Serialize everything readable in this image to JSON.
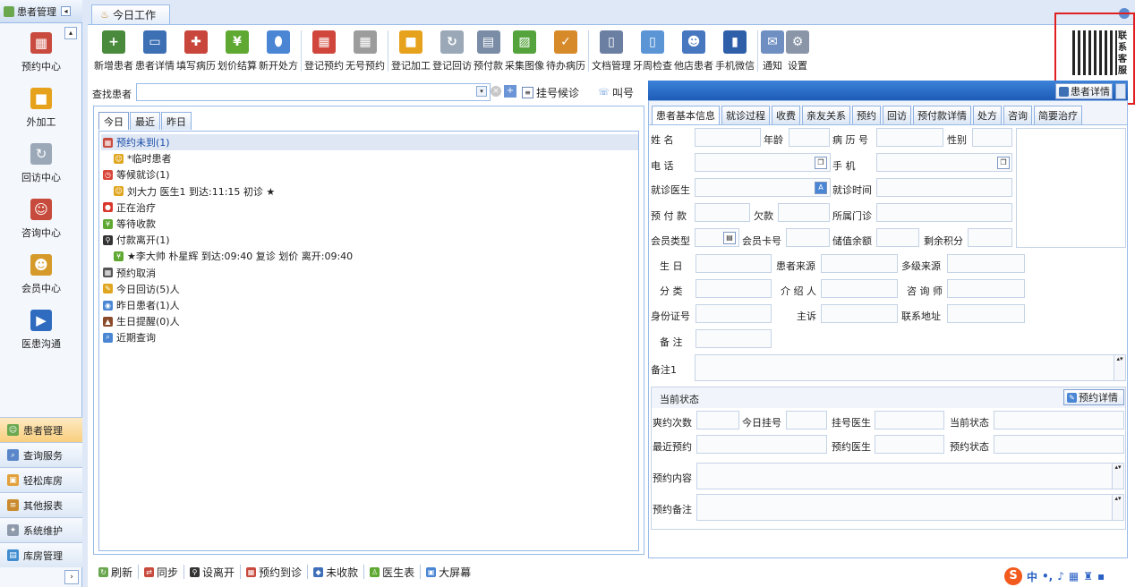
{
  "sidebar": {
    "header": "患者管理",
    "items": [
      {
        "label": "预约中心",
        "icon": "calendar-icon",
        "color": "#c94a3e"
      },
      {
        "label": "外加工",
        "icon": "blocks-icon",
        "color": "#e6a21c"
      },
      {
        "label": "回访中心",
        "icon": "refresh-icon",
        "color": "#9aa8b8"
      },
      {
        "label": "咨询中心",
        "icon": "consultant-icon",
        "color": "#c74b3c"
      },
      {
        "label": "会员中心",
        "icon": "members-icon",
        "color": "#d59a2a"
      },
      {
        "label": "医患沟通",
        "icon": "video-icon",
        "color": "#2f6cc0"
      }
    ],
    "menu": [
      {
        "label": "患者管理",
        "icon": "patients-icon",
        "color": "#6aa84f"
      },
      {
        "label": "查询服务",
        "icon": "query-icon",
        "color": "#5a87c9"
      },
      {
        "label": "轻松库房",
        "icon": "warehouse-icon",
        "color": "#e2a03a"
      },
      {
        "label": "其他报表",
        "icon": "report-icon",
        "color": "#c98b2e"
      },
      {
        "label": "系统维护",
        "icon": "wrench-icon",
        "color": "#8e9aab"
      },
      {
        "label": "库房管理",
        "icon": "storage-icon",
        "color": "#3f8ccf"
      }
    ]
  },
  "main_tab": {
    "label": "今日工作"
  },
  "toolbar": [
    {
      "label": "新增患者",
      "icon": "add-patient-icon",
      "color": "#4a8a3c"
    },
    {
      "label": "患者详情",
      "icon": "patient-card-icon",
      "color": "#3c6fb3"
    },
    {
      "label": "填写病历",
      "icon": "medical-record-icon",
      "color": "#c9463d"
    },
    {
      "label": "划价结算",
      "icon": "yen-icon",
      "color": "#5fa832"
    },
    {
      "label": "新开处方",
      "icon": "pill-icon",
      "color": "#4a86d4"
    },
    {
      "label": "登记预约",
      "icon": "calendar-icon",
      "color": "#d0463c"
    },
    {
      "label": "无号预约",
      "icon": "grid-calendar-icon",
      "color": "#9c9c9c"
    },
    {
      "label": "登记加工",
      "icon": "blocks-icon",
      "color": "#e6a21c"
    },
    {
      "label": "登记回访",
      "icon": "refresh-icon",
      "color": "#9aa8b8"
    },
    {
      "label": "预付款",
      "icon": "calculator-icon",
      "color": "#7a8ca6"
    },
    {
      "label": "采集图像",
      "icon": "image-icon",
      "color": "#55a33c"
    },
    {
      "label": "待办病历",
      "icon": "checklist-icon",
      "color": "#d68a2a"
    },
    {
      "label": "文档管理",
      "icon": "document-icon",
      "color": "#6b7fa3"
    },
    {
      "label": "牙周检查",
      "icon": "clipboard-icon",
      "color": "#5b95d6"
    },
    {
      "label": "他店患者",
      "icon": "users-icon",
      "color": "#4677bf"
    },
    {
      "label": "手机微信",
      "icon": "phone-icon",
      "color": "#2f5fa8"
    },
    {
      "label": "通知",
      "icon": "mail-icon",
      "color": "#6f8fc3"
    },
    {
      "label": "设置",
      "icon": "gear-icon",
      "color": "#8a96a8"
    }
  ],
  "qr": {
    "text": "联系客服"
  },
  "search": {
    "label": "查找患者",
    "value": ""
  },
  "actions": {
    "guahao": "挂号候诊",
    "jiaohao": "叫号"
  },
  "sub_tabs": [
    "今日",
    "最近",
    "昨日"
  ],
  "tree": [
    {
      "text": "预约未到(1)",
      "indent": 0,
      "icon": "calendar-icon",
      "color": "#c94a3e",
      "selected": true,
      "link": true
    },
    {
      "text": "*临时患者",
      "indent": 1,
      "icon": "smiley-icon",
      "color": "#e0a620"
    },
    {
      "text": "等候就诊(1)",
      "indent": 0,
      "icon": "clock-icon",
      "color": "#d9463a"
    },
    {
      "text": "刘大力 医生1 到达:11:15 初诊 ★",
      "indent": 1,
      "icon": "smiley-icon",
      "color": "#e0a620"
    },
    {
      "text": "正在治疗",
      "indent": 0,
      "icon": "drop-icon",
      "color": "#d9362a"
    },
    {
      "text": "等待收款",
      "indent": 0,
      "icon": "yen-icon",
      "color": "#5fa832"
    },
    {
      "text": "付款离开(1)",
      "indent": 0,
      "icon": "walking-icon",
      "color": "#333333"
    },
    {
      "text": "★李大帅 朴星辉 到达:09:40 复诊 划价 离开:09:40",
      "indent": 1,
      "icon": "yen-icon",
      "color": "#5fa832"
    },
    {
      "text": "预约取消",
      "indent": 0,
      "icon": "cancel-calendar-icon",
      "color": "#555555"
    },
    {
      "text": "今日回访(5)人",
      "indent": 0,
      "icon": "note-icon",
      "color": "#e0a620"
    },
    {
      "text": "昨日患者(1)人",
      "indent": 0,
      "icon": "eye-icon",
      "color": "#4a86d4"
    },
    {
      "text": "生日提醒(0)人",
      "indent": 0,
      "icon": "cake-icon",
      "color": "#8b4a2a"
    },
    {
      "text": "近期查询",
      "indent": 0,
      "icon": "search-icon",
      "color": "#4a86d4"
    }
  ],
  "bottom_bar": [
    {
      "label": "刷新",
      "icon": "refresh-icon",
      "color": "#6aa84f"
    },
    {
      "label": "同步",
      "icon": "sync-icon",
      "color": "#c94a3e"
    },
    {
      "label": "设离开",
      "icon": "walking-icon",
      "color": "#333333"
    },
    {
      "label": "预约到诊",
      "icon": "calendar-icon",
      "color": "#c94a3e"
    },
    {
      "label": "未收款",
      "icon": "money-icon",
      "color": "#3f6fb8"
    },
    {
      "label": "医生表",
      "icon": "doctor-icon",
      "color": "#5fa832"
    },
    {
      "label": "大屏幕",
      "icon": "screen-icon",
      "color": "#4a86d4"
    }
  ],
  "right": {
    "detail_button": "患者详情",
    "tabs": [
      "患者基本信息",
      "就诊过程",
      "收费",
      "亲友关系",
      "预约",
      "回访",
      "预付款详情",
      "处方",
      "咨询",
      "简要治疗"
    ],
    "fields": {
      "name": "姓  名",
      "age": "年龄",
      "record_no": "病 历 号",
      "gender": "性别",
      "phone": "电  话",
      "mobile": "手  机",
      "doctor": "就诊医生",
      "visit_time": "就诊时间",
      "prepay": "预 付 款",
      "owed": "欠款",
      "clinic": "所属门诊",
      "member_type": "会员类型",
      "member_card": "会员卡号",
      "balance": "储值余额",
      "points": "剩余积分",
      "birthday": "生  日",
      "source": "患者来源",
      "multi_source": "多级来源",
      "category": "分  类",
      "referrer": "介 绍 人",
      "consultant": "咨 询 师",
      "id_no": "身份证号",
      "complaint": "主诉",
      "address": "联系地址",
      "remark": "备  注",
      "remark1": "备注1"
    },
    "status": {
      "title": "当前状态",
      "button": "预约详情",
      "fields": {
        "missed": "爽约次数",
        "today_reg": "今日挂号",
        "reg_doctor": "挂号医生",
        "cur_status": "当前状态",
        "last_appt": "最近预约",
        "appt_doctor": "预约医生",
        "appt_status": "预约状态",
        "appt_content": "预约内容",
        "appt_note": "预约备注"
      }
    }
  },
  "ime": {
    "s": "S",
    "lang": "中",
    "punct": "•,"
  }
}
